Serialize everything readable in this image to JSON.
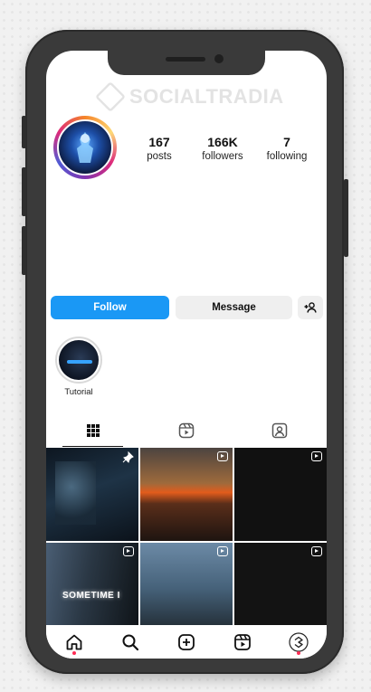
{
  "watermark": {
    "brand": "SOCIALTRADIA"
  },
  "profile": {
    "stats": [
      {
        "value": "167",
        "label": "posts"
      },
      {
        "value": "166K",
        "label": "followers"
      },
      {
        "value": "7",
        "label": "following"
      }
    ]
  },
  "actions": {
    "follow_label": "Follow",
    "message_label": "Message",
    "add_icon": "add-person-icon"
  },
  "highlights": [
    {
      "label": "Tutorial"
    }
  ],
  "tabs": [
    {
      "icon": "grid-icon",
      "active": true
    },
    {
      "icon": "reels-icon",
      "active": false
    },
    {
      "icon": "tagged-icon",
      "active": false
    }
  ],
  "grid": {
    "posts": [
      {
        "type": "photo",
        "overlay_text": ""
      },
      {
        "type": "reel",
        "overlay_text": ""
      },
      {
        "type": "reel",
        "overlay_text": ""
      },
      {
        "type": "reel",
        "overlay_text": "SOMETIME I"
      },
      {
        "type": "reel",
        "overlay_text": ""
      },
      {
        "type": "reel",
        "overlay_text": ""
      }
    ]
  },
  "nav": [
    {
      "icon": "home-icon"
    },
    {
      "icon": "search-icon"
    },
    {
      "icon": "create-icon"
    },
    {
      "icon": "reels-icon"
    },
    {
      "icon": "profile-icon"
    }
  ],
  "colors": {
    "follow": "#1a98f5",
    "message": "#efefef",
    "phone": "#3a3a3a"
  }
}
